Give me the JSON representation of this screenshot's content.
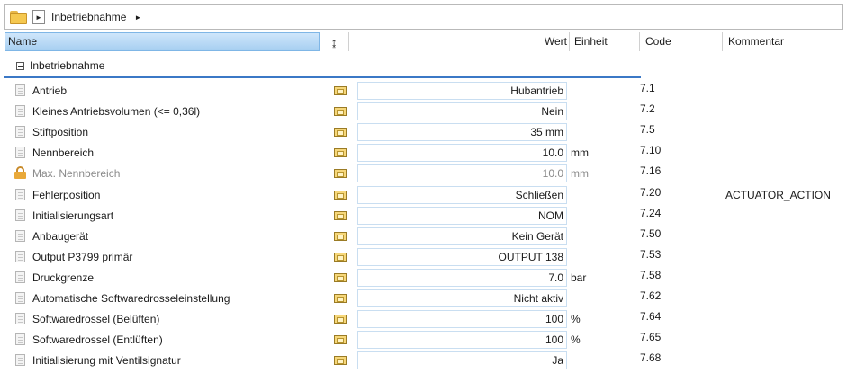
{
  "breadcrumb": {
    "folder_icon": "folder-icon",
    "nav_arrow": "►",
    "path_label": "Inbetriebnahme",
    "separator": "►"
  },
  "columns": {
    "name": "Name",
    "sort_icon": "↨",
    "wert": "Wert",
    "einheit": "Einheit",
    "code": "Code",
    "kommentar": "Kommentar"
  },
  "group": {
    "label": "Inbetriebnahme",
    "expanded": true
  },
  "rows": [
    {
      "label": "Antrieb",
      "value": "Hubantrieb",
      "unit": "",
      "code": "7.1",
      "comment": "",
      "locked": false
    },
    {
      "label": "Kleines Antriebsvolumen (<= 0,36l)",
      "value": "Nein",
      "unit": "",
      "code": "7.2",
      "comment": "",
      "locked": false
    },
    {
      "label": "Stiftposition",
      "value": "35 mm",
      "unit": "",
      "code": "7.5",
      "comment": "",
      "locked": false
    },
    {
      "label": "Nennbereich",
      "value": "10.0",
      "unit": "mm",
      "code": "7.10",
      "comment": "",
      "locked": false
    },
    {
      "label": "Max. Nennbereich",
      "value": "10.0",
      "unit": "mm",
      "code": "7.16",
      "comment": "",
      "locked": true
    },
    {
      "label": "Fehlerposition",
      "value": "Schließen",
      "unit": "",
      "code": "7.20",
      "comment": "ACTUATOR_ACTION",
      "locked": false
    },
    {
      "label": "Initialisierungsart",
      "value": "NOM",
      "unit": "",
      "code": "7.24",
      "comment": "",
      "locked": false
    },
    {
      "label": "Anbaugerät",
      "value": "Kein Gerät",
      "unit": "",
      "code": "7.50",
      "comment": "",
      "locked": false
    },
    {
      "label": "Output P3799 primär",
      "value": "OUTPUT 138",
      "unit": "",
      "code": "7.53",
      "comment": "",
      "locked": false
    },
    {
      "label": "Druckgrenze",
      "value": "7.0",
      "unit": "bar",
      "code": "7.58",
      "comment": "",
      "locked": false
    },
    {
      "label": "Automatische Softwaredrosseleinstellung",
      "value": "Nicht aktiv",
      "unit": "",
      "code": "7.62",
      "comment": "",
      "locked": false
    },
    {
      "label": "Softwaredrossel (Belüften)",
      "value": "100",
      "unit": "%",
      "code": "7.64",
      "comment": "",
      "locked": false
    },
    {
      "label": "Softwaredrossel (Entlüften)",
      "value": "100",
      "unit": "%",
      "code": "7.65",
      "comment": "",
      "locked": false
    },
    {
      "label": "Initialisierung mit Ventilsignatur",
      "value": "Ja",
      "unit": "",
      "code": "7.68",
      "comment": "",
      "locked": false
    }
  ],
  "colors": {
    "header_selected": "#a7cff1",
    "group_underline": "#3b78c6",
    "value_border": "#c9def1",
    "lock": "#e9a93a"
  }
}
